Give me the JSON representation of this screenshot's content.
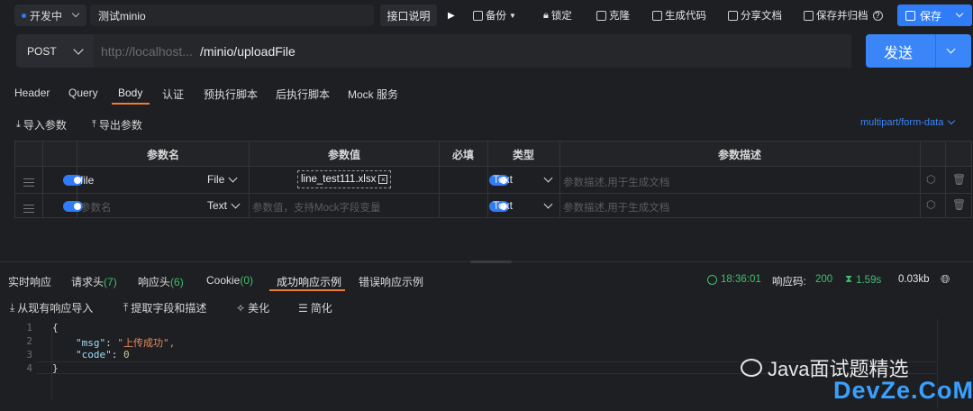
{
  "topbar": {
    "env_label": "开发中",
    "env_dot_color": "#2f7cf6",
    "api_name": "测试minio",
    "doc_btn": "接口说明",
    "backup": "备份",
    "lock": "锁定",
    "clone": "克隆",
    "gen_code": "生成代码",
    "share_doc": "分享文档",
    "save_archive": "保存并归档",
    "save": "保存",
    "accent": "#2f7cf6"
  },
  "request": {
    "method": "POST",
    "url_base": "http://localhost...",
    "url_path": "/minio/uploadFile",
    "send": "发送"
  },
  "req_tabs": [
    "Header",
    "Query",
    "Body",
    "认证",
    "预执行脚本",
    "后执行脚本",
    "Mock 服务"
  ],
  "active_req_tab": "Body",
  "body": {
    "import_params": "导入参数",
    "export_params": "导出参数",
    "content_type": "multipart/form-data",
    "columns": [
      "参数名",
      "参数值",
      "必填",
      "类型",
      "参数描述"
    ],
    "rows": [
      {
        "name": "file",
        "name_placeholder": "",
        "field_type": "File",
        "value": "line_test111.xlsx",
        "value_placeholder": "",
        "required": true,
        "type": "Text",
        "desc_placeholder": "参数描述,用于生成文档"
      },
      {
        "name": "",
        "name_placeholder": "参数名",
        "field_type": "Text",
        "value": "",
        "value_placeholder": "参数值，支持Mock字段变量",
        "required": true,
        "type": "Text",
        "desc_placeholder": "参数描述,用于生成文档"
      }
    ]
  },
  "response": {
    "tabs": [
      "实时响应",
      "请求头",
      "响应头",
      "Cookie",
      "成功响应示例",
      "错误响应示例"
    ],
    "req_header_count": "7",
    "resp_header_count": "6",
    "cookie_count": "0",
    "active_tab": "成功响应示例",
    "time": "18:36:01",
    "status_label": "响应码:",
    "status_code": "200",
    "duration": "1.59s",
    "size": "0.03kb",
    "tools": [
      "从现有响应导入",
      "提取字段和描述",
      "美化",
      "简化"
    ],
    "code_lines": [
      {
        "no": "1",
        "text": "{"
      },
      {
        "no": "2",
        "key": "\"msg\"",
        "val": "\"上传成功\","
      },
      {
        "no": "3",
        "key": "\"code\"",
        "val": "0"
      },
      {
        "no": "4",
        "text": "}"
      }
    ]
  },
  "watermark": {
    "brand": "Java面试题精选",
    "site": "DevZe.CoM"
  }
}
